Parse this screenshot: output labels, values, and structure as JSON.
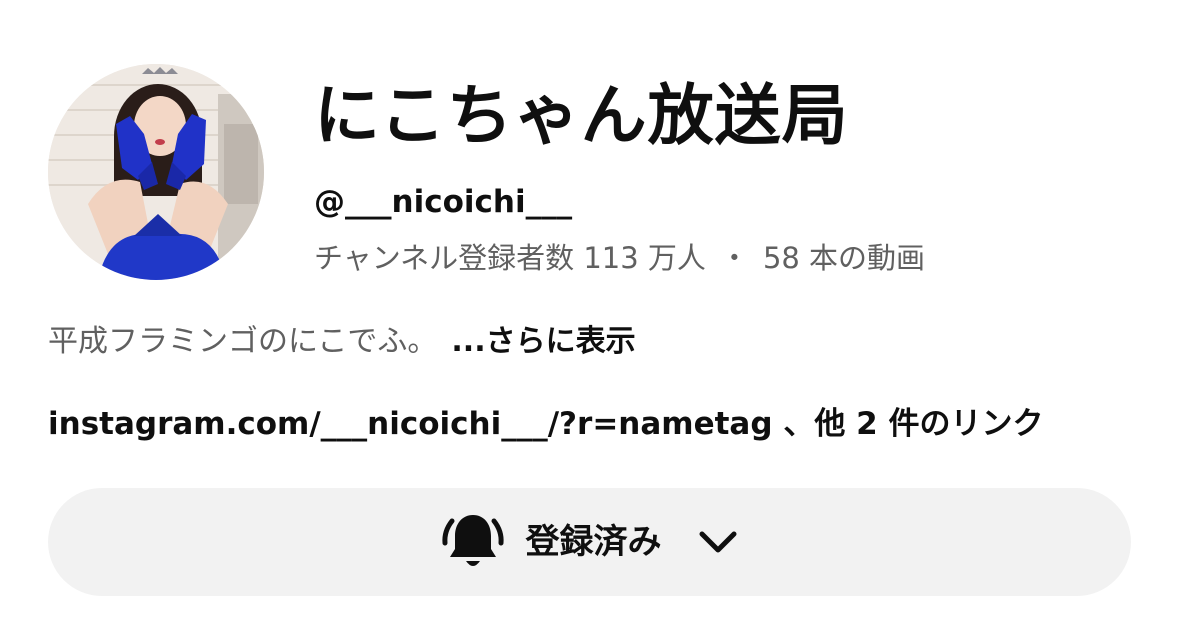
{
  "channel": {
    "name": "にこちゃん放送局",
    "handle": "@___nicoichi___",
    "subscribers": "チャンネル登録者数 113 万人",
    "separator": "・",
    "videos": "58 本の動画",
    "avatar_icon": "channel-avatar-photo"
  },
  "description": {
    "text": "平成フラミンゴのにこでふ。",
    "more_label": "...さらに表示"
  },
  "links": {
    "url": "instagram.com/___nicoichi___/?r=nametag",
    "more_label": "、他 2 件のリンク"
  },
  "subscribe_button": {
    "label": "登録済み",
    "icon": "bell-icon",
    "dropdown_icon": "chevron-down-icon"
  },
  "colors": {
    "background": "#ffffff",
    "primary_text": "#0f0f0f",
    "secondary_text": "#606060",
    "button_bg": "#f2f2f2"
  }
}
